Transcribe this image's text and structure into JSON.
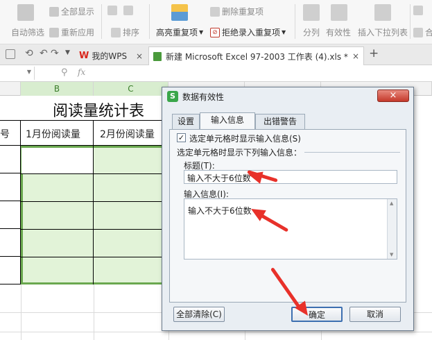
{
  "ribbon": {
    "auto_filter": "自动筛选",
    "show_all": "全部显示",
    "reapply": "重新应用",
    "sort": "排序",
    "highlight_duplicates": "高亮重复项",
    "remove_duplicates": "删除重复项",
    "reject_duplicate_entry": "拒绝录入重复项",
    "split_column": "分列",
    "validity": "有效性",
    "insert_dropdown": "插入下拉列表",
    "merge_partial": "合"
  },
  "tabs": {
    "wps_home": "我的WPS",
    "excel_file": "新建 Microsoft Excel 97-2003 工作表 (4).xls *"
  },
  "formula_bar": {
    "fx": "fx"
  },
  "columns": {
    "b": "B",
    "c": "C"
  },
  "sheet": {
    "title": "阅读量统计表",
    "col_a_header": "号",
    "col_b_header": "1月份阅读量",
    "col_c_header": "2月份阅读量"
  },
  "dialog": {
    "title": "数据有效性",
    "tab_settings": "设置",
    "tab_input_message": "输入信息",
    "tab_error_alert": "出错警告",
    "show_input_checkbox": "选定单元格时显示输入信息(S)",
    "show_input_checked": true,
    "group_label": "选定单元格时显示下列输入信息：",
    "title_label": "标题(T):",
    "title_value": "输入不大于6位数",
    "message_label": "输入信息(I):",
    "message_value": "输入不大于6位数",
    "clear_all": "全部清除(C)",
    "ok": "确定",
    "cancel": "取消"
  },
  "colors": {
    "selection_fill": "#e2f3d8",
    "selection_border": "#6aa84f",
    "annotation_arrow": "#e8312a",
    "wps_logo": "#d9261c"
  }
}
